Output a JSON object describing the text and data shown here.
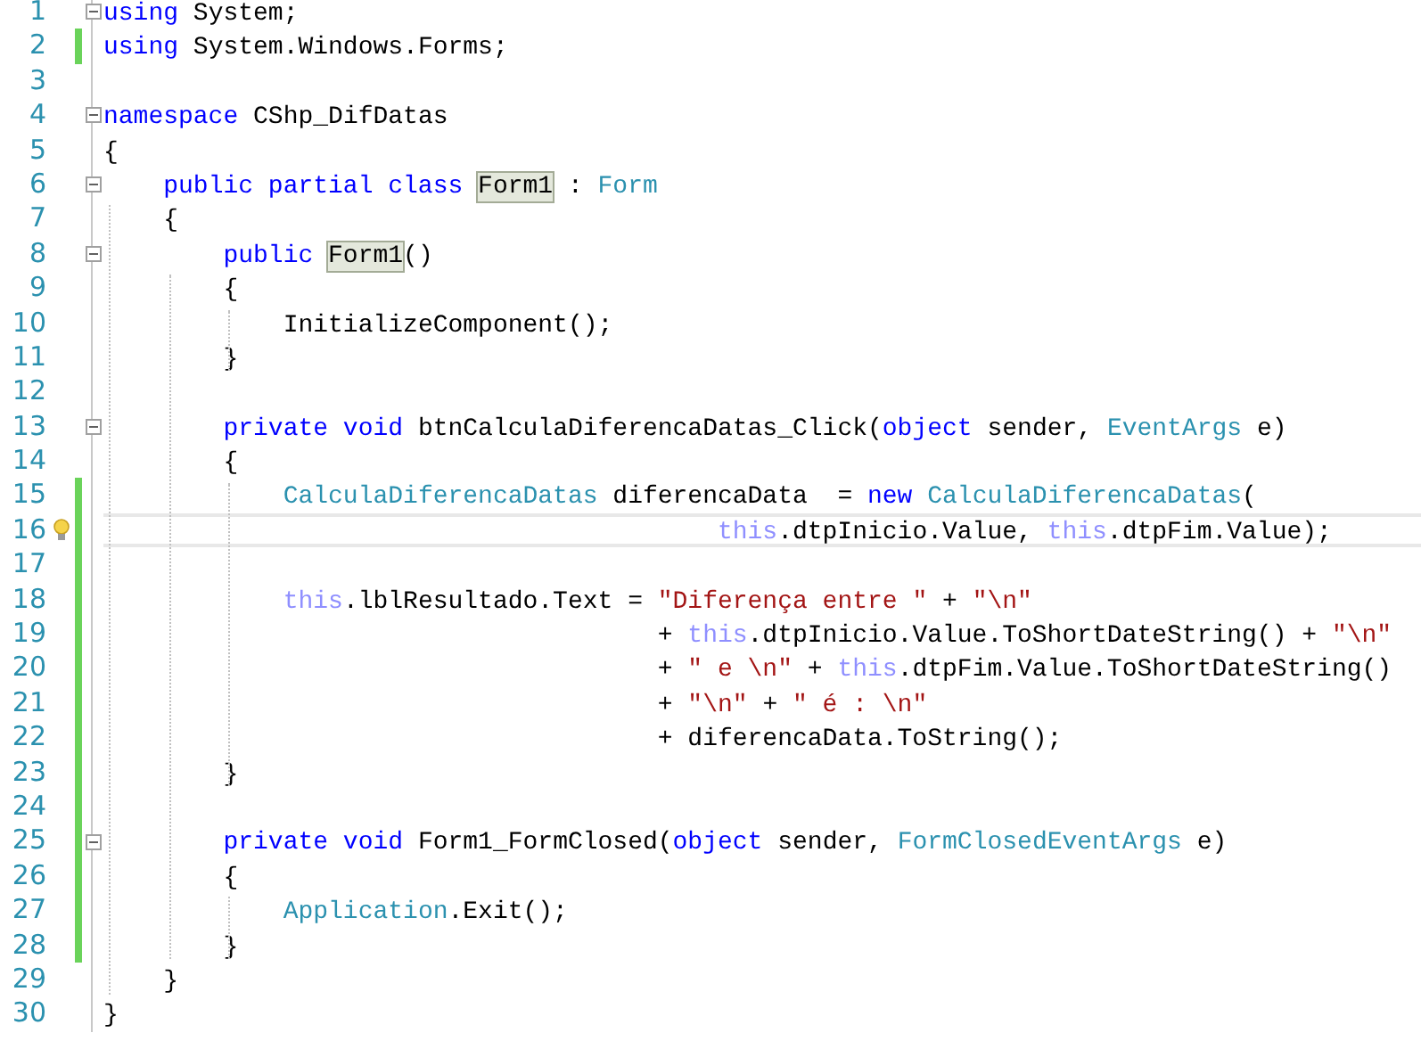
{
  "editor": {
    "lines": [
      {
        "number": "1",
        "changed": false,
        "fold": true,
        "current": false,
        "tokens": [
          {
            "kind": "keyword",
            "text": "using"
          },
          {
            "kind": "plain",
            "text": " System;"
          }
        ]
      },
      {
        "number": "2",
        "changed": true,
        "fold": false,
        "current": false,
        "tokens": [
          {
            "kind": "keyword",
            "text": "using"
          },
          {
            "kind": "plain",
            "text": " System.Windows.Forms;"
          }
        ]
      },
      {
        "number": "3",
        "changed": false,
        "fold": false,
        "current": false
      },
      {
        "number": "4",
        "changed": false,
        "fold": true,
        "current": false,
        "tokens": [
          {
            "kind": "keyword",
            "text": "namespace"
          },
          {
            "kind": "plain",
            "text": " CShp_DifDatas"
          }
        ]
      },
      {
        "number": "5",
        "changed": false,
        "fold": false,
        "current": false,
        "tokens": [
          {
            "kind": "plain",
            "text": "{"
          }
        ]
      },
      {
        "number": "6",
        "changed": false,
        "fold": true,
        "current": false,
        "tokens": [
          {
            "kind": "keyword",
            "text": "    public partial class "
          },
          {
            "kind": "reference",
            "text": "Form1"
          },
          {
            "kind": "plain",
            "text": " : "
          },
          {
            "kind": "type",
            "text": "Form"
          }
        ]
      },
      {
        "number": "7",
        "changed": false,
        "fold": false,
        "current": false,
        "tokens": [
          {
            "kind": "plain",
            "text": "    {"
          }
        ]
      },
      {
        "number": "8",
        "changed": false,
        "fold": true,
        "current": false,
        "tokens": [
          {
            "kind": "keyword",
            "text": "        public "
          },
          {
            "kind": "reference",
            "text": "Form1"
          },
          {
            "kind": "plain",
            "text": "()"
          }
        ]
      },
      {
        "number": "9",
        "changed": false,
        "fold": false,
        "current": false,
        "tokens": [
          {
            "kind": "plain",
            "text": "        {"
          }
        ]
      },
      {
        "number": "10",
        "changed": false,
        "fold": false,
        "current": false,
        "tokens": [
          {
            "kind": "plain",
            "text": "            InitializeComponent();"
          }
        ]
      },
      {
        "number": "11",
        "changed": false,
        "fold": false,
        "current": false,
        "tokens": [
          {
            "kind": "plain",
            "text": "        }"
          }
        ]
      },
      {
        "number": "12",
        "changed": false,
        "fold": false,
        "current": false
      },
      {
        "number": "13",
        "changed": false,
        "fold": true,
        "current": false,
        "tokens": [
          {
            "kind": "keyword",
            "text": "        private void"
          },
          {
            "kind": "plain",
            "text": " btnCalculaDiferencaDatas_Click("
          },
          {
            "kind": "keyword",
            "text": "object"
          },
          {
            "kind": "plain",
            "text": " sender, "
          },
          {
            "kind": "type",
            "text": "EventArgs"
          },
          {
            "kind": "plain",
            "text": " e)"
          }
        ]
      },
      {
        "number": "14",
        "changed": false,
        "fold": false,
        "current": false,
        "tokens": [
          {
            "kind": "plain",
            "text": "        {"
          }
        ]
      },
      {
        "number": "15",
        "changed": true,
        "fold": false,
        "current": false,
        "tokens": [
          {
            "kind": "type",
            "text": "            CalculaDiferencaDatas"
          },
          {
            "kind": "plain",
            "text": " diferencaData  = "
          },
          {
            "kind": "keyword",
            "text": "new "
          },
          {
            "kind": "type",
            "text": "CalculaDiferencaDatas"
          },
          {
            "kind": "plain",
            "text": "("
          }
        ]
      },
      {
        "number": "16",
        "changed": true,
        "fold": false,
        "current": true,
        "tokens": [
          {
            "kind": "instance",
            "text": "                                         this"
          },
          {
            "kind": "plain",
            "text": ".dtpInicio.Value, "
          },
          {
            "kind": "instance",
            "text": "this"
          },
          {
            "kind": "plain",
            "text": ".dtpFim.Value);"
          }
        ]
      },
      {
        "number": "17",
        "changed": true,
        "fold": false,
        "current": false
      },
      {
        "number": "18",
        "changed": true,
        "fold": false,
        "current": false,
        "tokens": [
          {
            "kind": "instance",
            "text": "            this"
          },
          {
            "kind": "plain",
            "text": ".lblResultado.Text = "
          },
          {
            "kind": "string",
            "text": "\"Diferença entre \""
          },
          {
            "kind": "plain",
            "text": " + "
          },
          {
            "kind": "string",
            "text": "\"\\n\""
          }
        ]
      },
      {
        "number": "19",
        "changed": true,
        "fold": false,
        "current": false,
        "tokens": [
          {
            "kind": "plain",
            "text": "                                     + "
          },
          {
            "kind": "instance",
            "text": "this"
          },
          {
            "kind": "plain",
            "text": ".dtpInicio.Value.ToShortDateString() + "
          },
          {
            "kind": "string",
            "text": "\"\\n\""
          }
        ]
      },
      {
        "number": "20",
        "changed": true,
        "fold": false,
        "current": false,
        "tokens": [
          {
            "kind": "plain",
            "text": "                                     + "
          },
          {
            "kind": "string",
            "text": "\" e \\n\""
          },
          {
            "kind": "plain",
            "text": " + "
          },
          {
            "kind": "instance",
            "text": "this"
          },
          {
            "kind": "plain",
            "text": ".dtpFim.Value.ToShortDateString()"
          }
        ]
      },
      {
        "number": "21",
        "changed": true,
        "fold": false,
        "current": false,
        "tokens": [
          {
            "kind": "plain",
            "text": "                                     + "
          },
          {
            "kind": "string",
            "text": "\"\\n\""
          },
          {
            "kind": "plain",
            "text": " + "
          },
          {
            "kind": "string",
            "text": "\" é : \\n\""
          }
        ]
      },
      {
        "number": "22",
        "changed": true,
        "fold": false,
        "current": false,
        "tokens": [
          {
            "kind": "plain",
            "text": "                                     + diferencaData.ToString();"
          }
        ]
      },
      {
        "number": "23",
        "changed": true,
        "fold": false,
        "current": false,
        "tokens": [
          {
            "kind": "plain",
            "text": "        }"
          }
        ]
      },
      {
        "number": "24",
        "changed": true,
        "fold": false,
        "current": false
      },
      {
        "number": "25",
        "changed": true,
        "fold": true,
        "current": false,
        "tokens": [
          {
            "kind": "keyword",
            "text": "        private void"
          },
          {
            "kind": "plain",
            "text": " Form1_FormClosed("
          },
          {
            "kind": "keyword",
            "text": "object"
          },
          {
            "kind": "plain",
            "text": " sender, "
          },
          {
            "kind": "type",
            "text": "FormClosedEventArgs"
          },
          {
            "kind": "plain",
            "text": " e)"
          }
        ]
      },
      {
        "number": "26",
        "changed": true,
        "fold": false,
        "current": false,
        "tokens": [
          {
            "kind": "plain",
            "text": "        {"
          }
        ]
      },
      {
        "number": "27",
        "changed": true,
        "fold": false,
        "current": false,
        "tokens": [
          {
            "kind": "type",
            "text": "            Application"
          },
          {
            "kind": "plain",
            "text": ".Exit();"
          }
        ]
      },
      {
        "number": "28",
        "changed": true,
        "fold": false,
        "current": false,
        "tokens": [
          {
            "kind": "plain",
            "text": "        }"
          }
        ]
      },
      {
        "number": "29",
        "changed": false,
        "fold": false,
        "current": false,
        "tokens": [
          {
            "kind": "plain",
            "text": "    }"
          }
        ]
      },
      {
        "number": "30",
        "changed": false,
        "fold": false,
        "current": false,
        "tokens": [
          {
            "kind": "plain",
            "text": "}"
          }
        ]
      }
    ]
  }
}
